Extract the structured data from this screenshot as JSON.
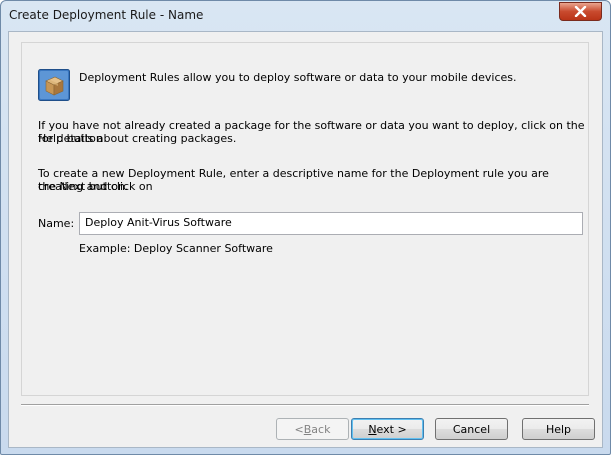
{
  "window": {
    "title": "Create Deployment Rule - Name"
  },
  "intro": "Deployment Rules allow you to deploy software or data to your mobile devices.",
  "help_text": [
    "If you have not already created a package for the software or data you want to deploy, click on the Help button",
    "for details about creating packages."
  ],
  "instructions": [
    "To create a new Deployment Rule, enter a descriptive name for the Deployment rule you are creating and click on",
    "the Next button."
  ],
  "name_field": {
    "label": "Name:",
    "value": "Deploy Anit-Virus Software"
  },
  "example": "Example: Deploy Scanner Software",
  "buttons": {
    "back": {
      "pre": "< ",
      "key": "B",
      "post": "ack"
    },
    "next": {
      "key": "N",
      "post": "ext >"
    },
    "cancel": "Cancel",
    "help": "Help"
  }
}
